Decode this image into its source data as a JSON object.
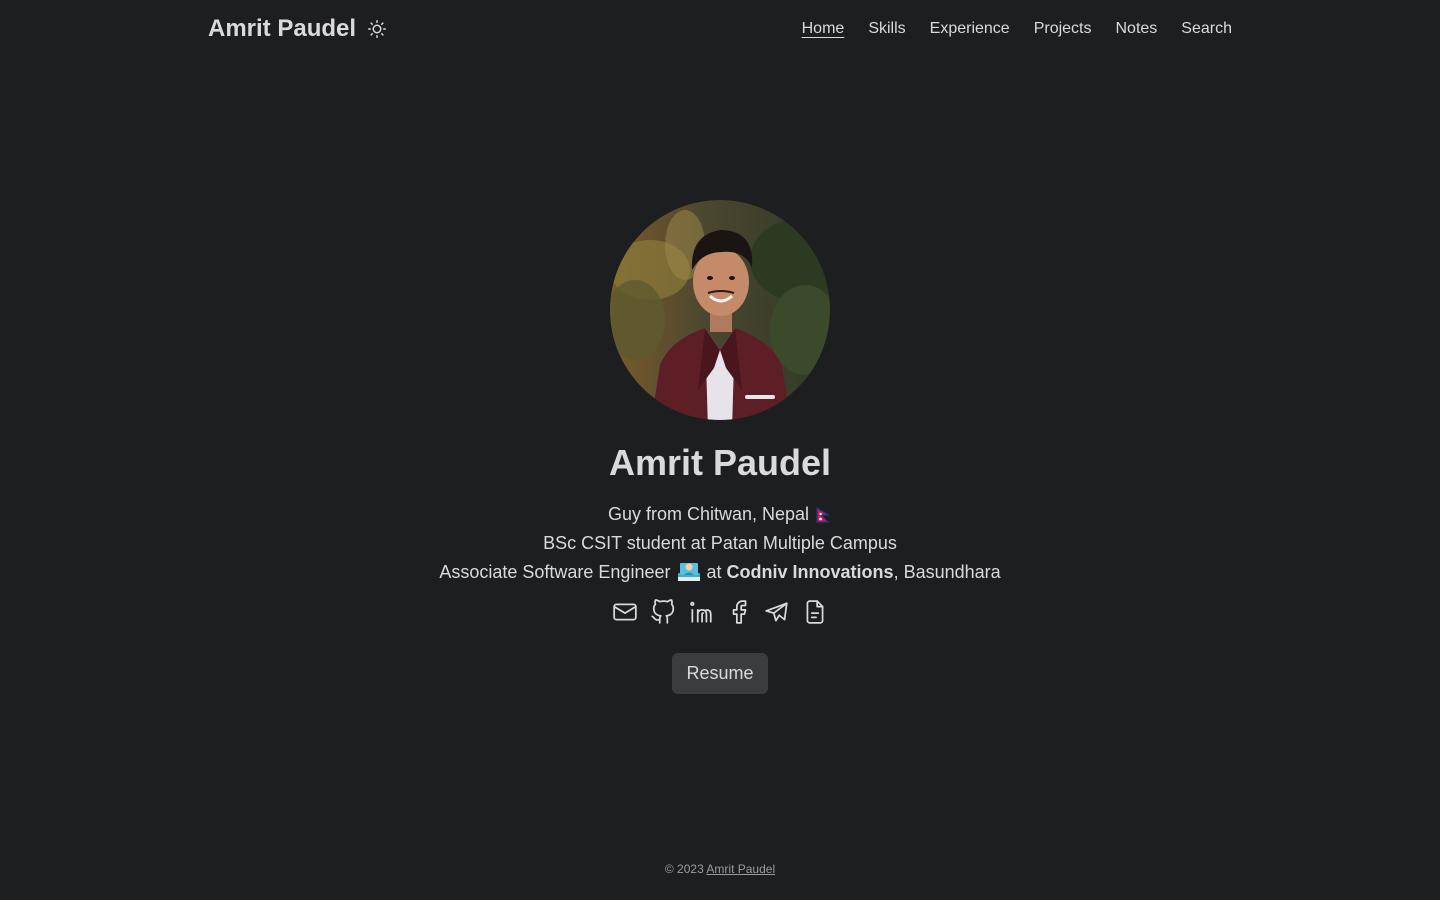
{
  "header": {
    "brand": "Amrit Paudel",
    "theme_icon": "sun-icon",
    "nav": [
      {
        "label": "Home",
        "active": true
      },
      {
        "label": "Skills"
      },
      {
        "label": "Experience"
      },
      {
        "label": "Projects"
      },
      {
        "label": "Notes"
      },
      {
        "label": "Search"
      }
    ]
  },
  "profile": {
    "avatar": "avatar-photo",
    "name": "Amrit Paudel",
    "bio": {
      "line1": "Guy from Chitwan, Nepal",
      "line1_emoji": "nepal-flag",
      "line2": "BSc CSIT student at Patan Multiple Campus",
      "line3_prefix": "Associate Software Engineer",
      "line3_emoji": "technologist",
      "line3_at": "at",
      "line3_company": "Codniv Innovations",
      "line3_suffix": ", Basundhara"
    },
    "socials": [
      "mail-icon",
      "github-icon",
      "linkedin-icon",
      "facebook-icon",
      "telegram-icon",
      "document-icon"
    ],
    "resume_label": "Resume"
  },
  "footer": {
    "copyright": "© 2023",
    "author_link": "Amrit Paudel"
  },
  "colors": {
    "background": "#1d1e20",
    "text": "#dadadb",
    "button": "#3b3c3e",
    "muted": "#9b9c9d"
  }
}
